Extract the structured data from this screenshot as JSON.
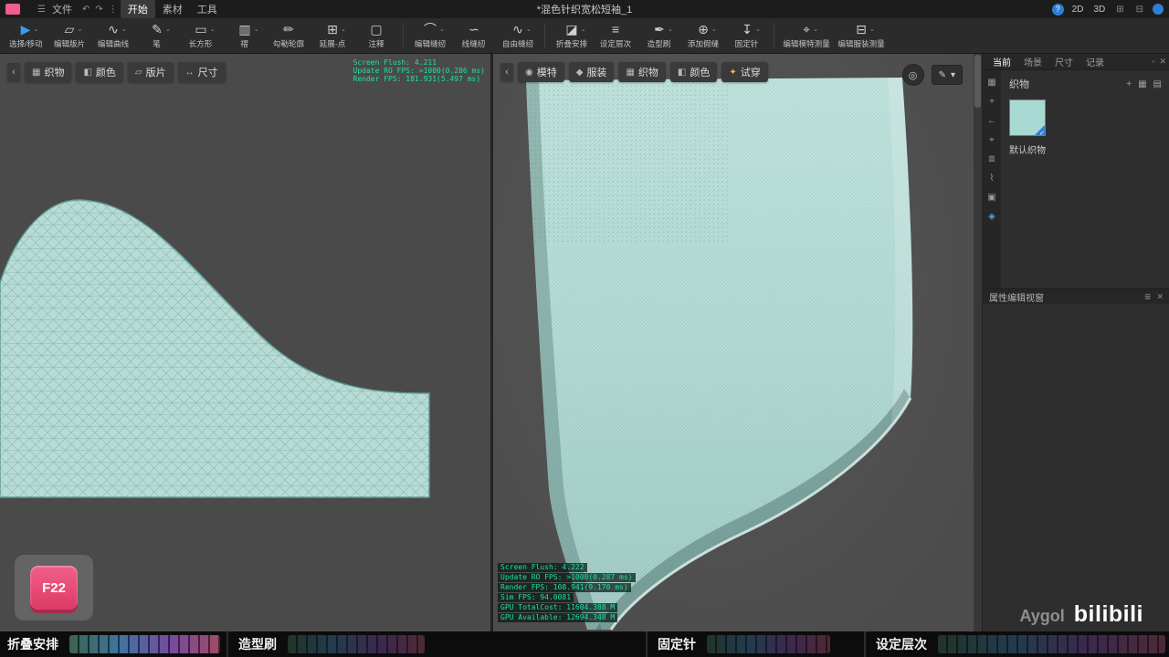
{
  "menubar": {
    "items": [
      {
        "label": "文件"
      },
      {
        "label": "开始"
      },
      {
        "label": "素材"
      },
      {
        "label": "工具"
      }
    ],
    "title": "*混色针织宽松短袖_1",
    "right_2d": "2D",
    "right_3d": "3D"
  },
  "icons": {
    "menu": "☰",
    "undo": "↶",
    "redo": "↷",
    "kebab": "⋮",
    "help": "?",
    "grid": "⊞",
    "layout": "⊟",
    "chevron_left": "‹",
    "caret": "⌄",
    "close": "✕",
    "pin_panel": "▫",
    "plus": "+",
    "thumb_grid": "▦",
    "thumb_list": "▤",
    "target": "◎",
    "pen": "✎",
    "down": "▾",
    "list": "≣"
  },
  "toolbar": {
    "caret": "⌄",
    "tools": [
      {
        "label": "选择/移动",
        "glyph": "▶"
      },
      {
        "label": "编辑版片",
        "glyph": "▱"
      },
      {
        "label": "编辑曲线",
        "glyph": "∿"
      },
      {
        "label": "笔",
        "glyph": "✎"
      },
      {
        "label": "长方形",
        "glyph": "▭"
      },
      {
        "label": "褶",
        "glyph": "▥"
      },
      {
        "label": "勾勒轮廓",
        "glyph": "✏"
      },
      {
        "label": "延展-点",
        "glyph": "⊞"
      },
      {
        "label": "注释",
        "glyph": "▢"
      },
      {
        "label": "编辑缝纫",
        "glyph": "⌒"
      },
      {
        "label": "线缝纫",
        "glyph": "∽"
      },
      {
        "label": "自由缝纫",
        "glyph": "∿"
      },
      {
        "label": "折叠安排",
        "glyph": "◪"
      },
      {
        "label": "设定层次",
        "glyph": "≡"
      },
      {
        "label": "造型刷",
        "glyph": "✒"
      },
      {
        "label": "添加假缝",
        "glyph": "⊕"
      },
      {
        "label": "固定针",
        "glyph": "↧"
      },
      {
        "label": "编辑模特测量",
        "glyph": "⌖"
      },
      {
        "label": "编辑服装测量",
        "glyph": "⊟"
      }
    ]
  },
  "panel2d": {
    "tabs": [
      {
        "label": "织物",
        "glyph": "▦"
      },
      {
        "label": "颜色",
        "glyph": "◧"
      },
      {
        "label": "版片",
        "glyph": "▱"
      },
      {
        "label": "尺寸",
        "glyph": "↔"
      }
    ],
    "debug": [
      "Screen Flush: 4.211",
      "Update RO FPS: >1000(0.286 ms)",
      "Render FPS: 181.931(5.497 ms)"
    ],
    "hotkey": "F22"
  },
  "panel3d": {
    "tabs": [
      {
        "label": "模特",
        "glyph": "◉"
      },
      {
        "label": "服装",
        "glyph": "◆"
      },
      {
        "label": "织物",
        "glyph": "▦"
      },
      {
        "label": "颜色",
        "glyph": "◧"
      },
      {
        "label": "试穿",
        "glyph": "✦"
      }
    ],
    "debug": [
      "Screen Flush: 4.222",
      "Update RO FPS: >1000(0.287 ms)",
      "Render FPS: 108.941(9.170 ms)",
      "Sim FPS: 94.0081",
      "GPU TotalCost: 11604.388 M",
      "GPU Available: 12694.348 M"
    ]
  },
  "sidebar": {
    "tabs": [
      "当前",
      "场景",
      "尺寸",
      "记录"
    ],
    "section": "织物",
    "swatch_label": "默认织物",
    "property_header": "属性编辑视窗",
    "rail": [
      "▦",
      "+",
      "←",
      "⌖",
      "≣",
      "⌇",
      "▣",
      "◈"
    ]
  },
  "bottombar": {
    "labels": [
      "折叠安排",
      "造型刷",
      "固定针",
      "设定层次"
    ]
  },
  "watermark": {
    "artist": "Aygol",
    "site": "bilibili"
  },
  "colors": {
    "accent": "#3d9be9",
    "fabric": "#aedad4",
    "debug_green": "#1fe0a0",
    "hotkey_pink": "#e84a71"
  }
}
